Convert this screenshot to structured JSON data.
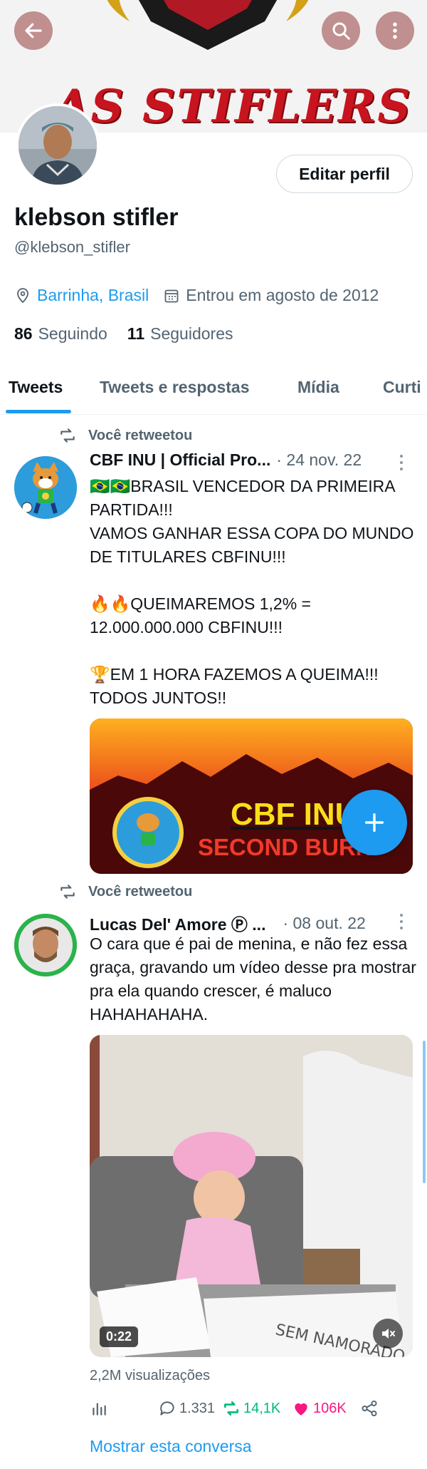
{
  "profile": {
    "banner_text": "AS STIFLERS",
    "edit_label": "Editar perfil",
    "name": "klebson stifler",
    "handle": "@klebson_stifler",
    "location": "Barrinha, Brasil",
    "joined": "Entrou em agosto de 2012",
    "following_count": "86",
    "following_label": "Seguindo",
    "followers_count": "11",
    "followers_label": "Seguidores"
  },
  "tabs": [
    {
      "label": "Tweets",
      "active": true
    },
    {
      "label": "Tweets e respostas",
      "active": false
    },
    {
      "label": "Mídia",
      "active": false
    },
    {
      "label": "Curti",
      "active": false
    }
  ],
  "tweets": [
    {
      "retweet_label": "Você retweetou",
      "author": "CBF INU | Official Pro...",
      "date": "· 24 nov. 22",
      "text": "🇧🇷🇧🇷BRASIL VENCEDOR DA PRIMEIRA PARTIDA!!!\nVAMOS GANHAR ESSA COPA DO MUNDO DE TITULARES CBFINU!!!\n\n🔥🔥QUEIMAREMOS 1,2% = 12.000.000.000 CBFINU!!!\n\n🏆EM 1 HORA FAZEMOS A QUEIMA!!! TODOS JUNTOS!!",
      "media_text_1": "CBF INU",
      "media_text_2": "SECOND BURN"
    },
    {
      "retweet_label": "Você retweetou",
      "author": "Lucas Del' Amore Ⓟ ...",
      "date": "· 08 out. 22",
      "text": "O cara que é pai de menina, e não fez essa graça, gravando um vídeo desse pra mostrar pra ela quando crescer, é maluco HAHAHAHAHA.",
      "video_time": "0:22",
      "views": "2,2M visualizações",
      "replies": "1.331",
      "retweets": "14,1K",
      "likes": "106K",
      "show_conversation": "Mostrar esta conversa"
    }
  ],
  "colors": {
    "accent": "#1d9bf0",
    "retweet": "#00ba7c",
    "like": "#f91880",
    "muted": "#536471"
  }
}
